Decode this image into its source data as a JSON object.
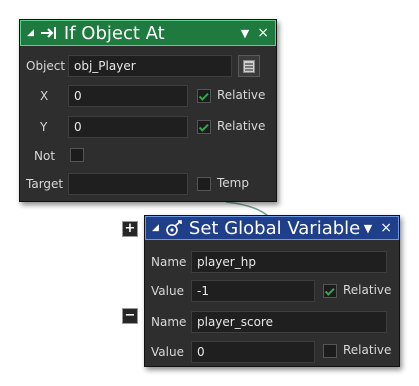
{
  "if_object_at": {
    "title": "If Object At",
    "header_color": "#1e7a3e",
    "object": {
      "label": "Object",
      "value": "obj_Player"
    },
    "x": {
      "label": "X",
      "value": "0",
      "relative_label": "Relative",
      "relative_checked": true
    },
    "y": {
      "label": "Y",
      "value": "0",
      "relative_label": "Relative",
      "relative_checked": true
    },
    "not": {
      "label": "Not",
      "checked": false
    },
    "target": {
      "label": "Target",
      "value": "",
      "temp_label": "Temp",
      "temp_checked": false
    }
  },
  "set_global_variable": {
    "title": "Set Global Variable",
    "header_color": "#1f3f8a",
    "expand_label": "+",
    "rows": [
      {
        "name_label": "Name",
        "name_value": "player_hp",
        "value_label": "Value",
        "value_value": "-1",
        "relative_label": "Relative",
        "relative_checked": true
      },
      {
        "remove_label": "−",
        "name_label": "Name",
        "name_value": "player_score",
        "value_label": "Value",
        "value_value": "0",
        "relative_label": "Relative",
        "relative_checked": false
      }
    ]
  }
}
